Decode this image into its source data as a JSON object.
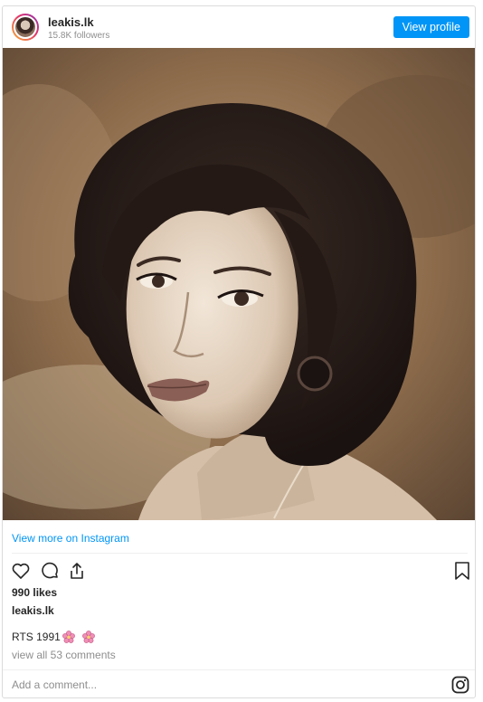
{
  "header": {
    "username": "leakis.lk",
    "followers": "15.8K followers",
    "view_profile_label": "View profile"
  },
  "post": {
    "view_more_label": "View more on Instagram",
    "likes": "990 likes",
    "caption_user": "leakis.lk",
    "caption_text": "RTS 1991",
    "comments_link": "view all 53 comments",
    "add_comment_placeholder": "Add a comment..."
  },
  "icons": [
    "heart-icon",
    "comment-icon",
    "share-icon",
    "bookmark-icon",
    "flower-emoji-icon",
    "instagram-logo-icon"
  ],
  "colors": {
    "accent": "#0095f6",
    "text": "#262626",
    "muted": "#8e8e8e",
    "border": "#dbdbdb"
  }
}
